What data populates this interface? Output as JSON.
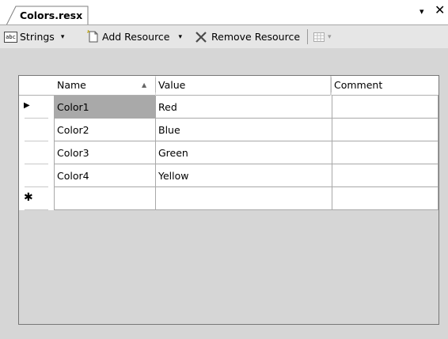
{
  "tab": {
    "title": "Colors.resx",
    "dropdown": "▾",
    "close": "✕"
  },
  "toolbar": {
    "strings_icon": "abc",
    "strings_label": "Strings",
    "strings_arrow": "▾",
    "add_label": "Add Resource",
    "add_arrow": "▾",
    "remove_label": "Remove Resource",
    "grid_arrow": "▾"
  },
  "grid": {
    "columns": [
      "Name",
      "Value",
      "Comment"
    ],
    "rows": [
      {
        "name": "Color1",
        "value": "Red",
        "comment": ""
      },
      {
        "name": "Color2",
        "value": "Blue",
        "comment": ""
      },
      {
        "name": "Color3",
        "value": "Green",
        "comment": ""
      },
      {
        "name": "Color4",
        "value": "Yellow",
        "comment": ""
      }
    ],
    "current_row_marker": "▶",
    "new_row_marker": "✱"
  }
}
